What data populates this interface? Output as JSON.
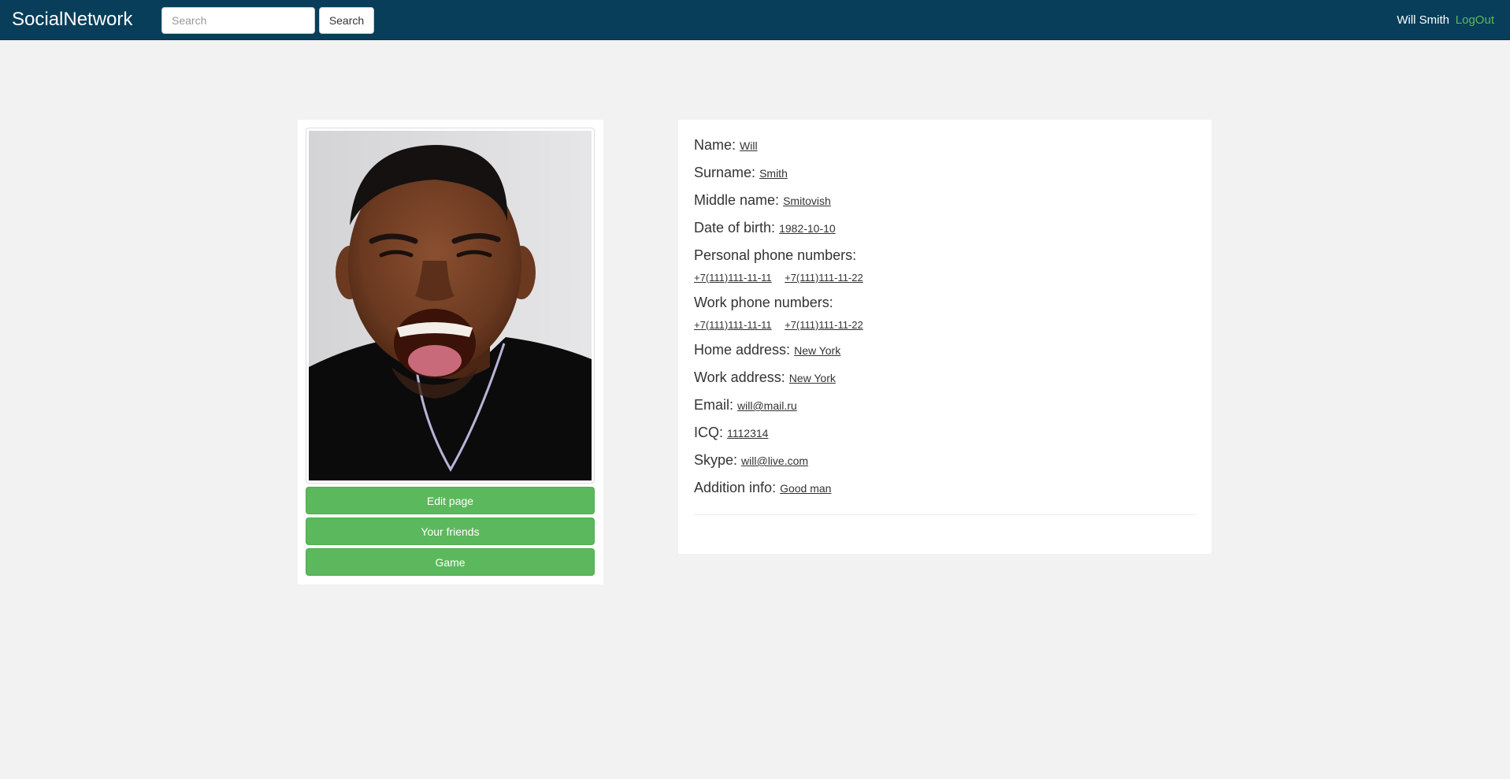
{
  "navbar": {
    "brand": "SocialNetwork",
    "search_placeholder": "Search",
    "search_button": "Search",
    "user_name": "Will Smith",
    "logout": "LogOut"
  },
  "sidebar": {
    "buttons": {
      "edit": "Edit page",
      "friends": "Your friends",
      "game": "Game"
    }
  },
  "profile": {
    "name": {
      "label": "Name:",
      "value": "Will"
    },
    "surname": {
      "label": "Surname:",
      "value": "Smith"
    },
    "middle": {
      "label": "Middle name:",
      "value": "Smitovish"
    },
    "birth": {
      "label": "Date of birth:",
      "value": "1982-10-10"
    },
    "personal_phones": {
      "label": "Personal phone numbers:",
      "numbers": [
        "+7(111)111-11-11",
        "+7(111)111-11-22"
      ]
    },
    "work_phones": {
      "label": "Work phone numbers:",
      "numbers": [
        "+7(111)111-11-11",
        "+7(111)111-11-22"
      ]
    },
    "home_address": {
      "label": "Home address:",
      "value": "New York"
    },
    "work_address": {
      "label": "Work address:",
      "value": "New York"
    },
    "email": {
      "label": "Email:",
      "value": "will@mail.ru"
    },
    "icq": {
      "label": "ICQ:",
      "value": "1112314"
    },
    "skype": {
      "label": "Skype:",
      "value": "will@live.com"
    },
    "addition": {
      "label": "Addition info:",
      "value": "Good man"
    }
  },
  "colors": {
    "navbar": "#083e5a",
    "accent_green": "#5cb85c",
    "page_background": "#f2f2f2"
  }
}
